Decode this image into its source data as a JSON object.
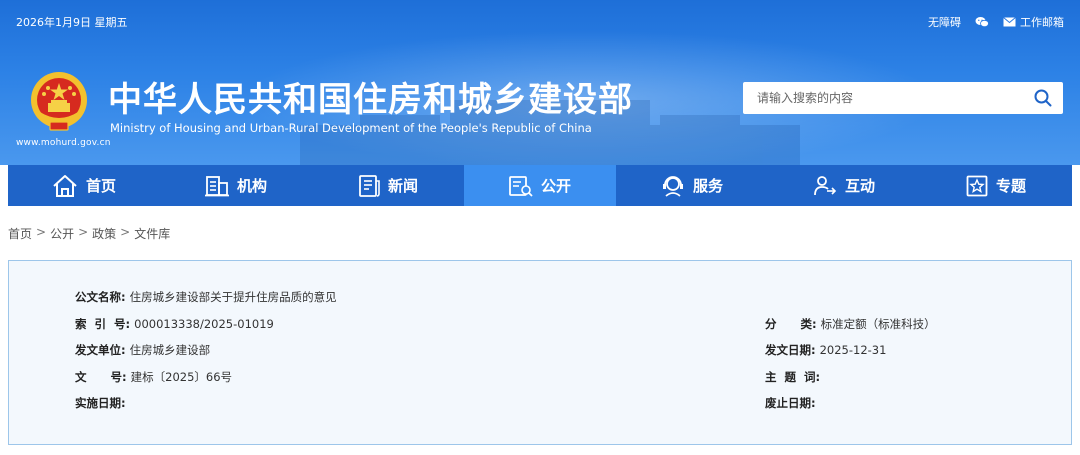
{
  "header": {
    "date": "2026年1月9日 星期五",
    "links": {
      "accessibility": "无障碍",
      "email": "工作邮箱"
    },
    "site_url": "www.mohurd.gov.cn",
    "title_cn": "中华人民共和国住房和城乡建设部",
    "title_en": "Ministry of Housing and Urban-Rural Development of the People's Republic of China",
    "search": {
      "placeholder": "请输入搜索的内容"
    }
  },
  "nav": {
    "items": [
      {
        "label": "首页",
        "icon": "home-icon"
      },
      {
        "label": "机构",
        "icon": "building-icon"
      },
      {
        "label": "新闻",
        "icon": "news-icon"
      },
      {
        "label": "公开",
        "icon": "open-icon",
        "active": true
      },
      {
        "label": "服务",
        "icon": "service-icon"
      },
      {
        "label": "互动",
        "icon": "interact-icon"
      },
      {
        "label": "专题",
        "icon": "topic-icon"
      }
    ]
  },
  "breadcrumb": [
    "首页",
    "公开",
    "政策",
    "文件库"
  ],
  "document": {
    "name_label": "公文名称:",
    "name_value": "住房城乡建设部关于提升住房品质的意见",
    "index_label": "索  引  号:",
    "index_value": "000013338/2025-01019",
    "category_label": "分      类:",
    "category_value": "标准定额（标准科技）",
    "issuer_label": "发文单位:",
    "issuer_value": "住房城乡建设部",
    "issue_date_label": "发文日期:",
    "issue_date_value": "2025-12-31",
    "docno_label": "文      号:",
    "docno_value": "建标〔2025〕66号",
    "subject_label": "主  题  词:",
    "subject_value": "",
    "effective_label": "实施日期:",
    "effective_value": "",
    "repeal_label": "废止日期:",
    "repeal_value": ""
  },
  "colors": {
    "header_blue": "#1e6fd8",
    "nav_blue": "#1f64c8",
    "nav_active": "#3b8ff0",
    "panel_bg": "#f3f8fd",
    "panel_border": "#9dc6ea"
  }
}
